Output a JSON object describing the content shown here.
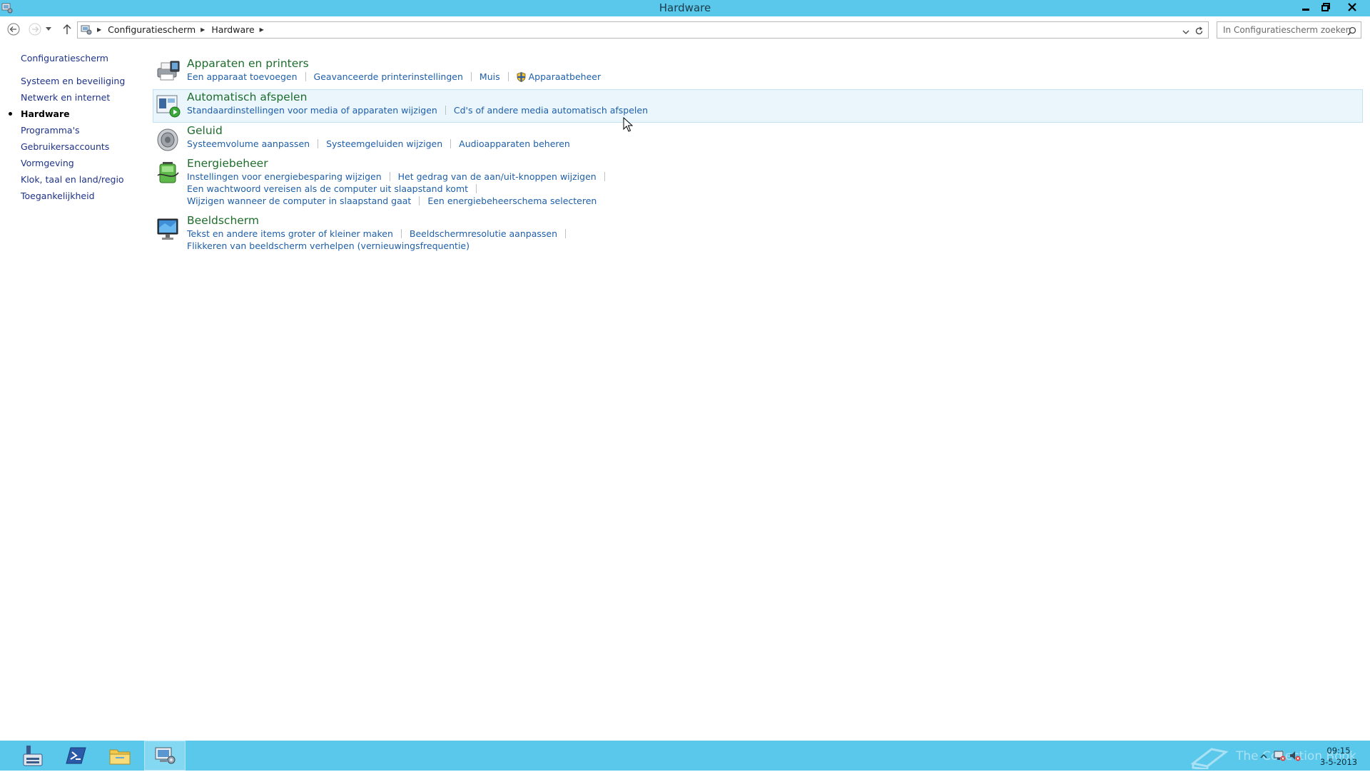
{
  "window": {
    "title": "Hardware",
    "controls": {
      "minimize": "minimize-icon",
      "restore": "restore-icon",
      "close": "close-icon"
    }
  },
  "navbar": {
    "breadcrumbs": [
      "Configuratiescherm",
      "Hardware"
    ],
    "search_placeholder": "In Configuratiescherm zoeken"
  },
  "sidebar": {
    "home": "Configuratiescherm",
    "items": [
      {
        "label": "Systeem en beveiliging",
        "current": false
      },
      {
        "label": "Netwerk en internet",
        "current": false
      },
      {
        "label": "Hardware",
        "current": true
      },
      {
        "label": "Programma's",
        "current": false
      },
      {
        "label": "Gebruikersaccounts",
        "current": false
      },
      {
        "label": "Vormgeving",
        "current": false
      },
      {
        "label": "Klok, taal en land/regio",
        "current": false
      },
      {
        "label": "Toegankelijkheid",
        "current": false
      }
    ]
  },
  "categories": [
    {
      "title": "Apparaten en printers",
      "icon": "devices-printers-icon",
      "rows": [
        [
          "Een apparaat toevoegen",
          "Geavanceerde printerinstellingen",
          "Muis",
          "Apparaatbeheer"
        ]
      ]
    },
    {
      "title": "Automatisch afspelen",
      "icon": "autoplay-icon",
      "rows": [
        [
          "Standaardinstellingen voor media of apparaten wijzigen",
          "Cd's of andere media automatisch afspelen"
        ]
      ]
    },
    {
      "title": "Geluid",
      "icon": "speaker-icon",
      "rows": [
        [
          "Systeemvolume aanpassen",
          "Systeemgeluiden wijzigen",
          "Audioapparaten beheren"
        ]
      ]
    },
    {
      "title": "Energiebeheer",
      "icon": "battery-icon",
      "rows": [
        [
          "Instellingen voor energiebesparing wijzigen",
          "Het gedrag van de aan/uit-knoppen wijzigen"
        ],
        [
          "Een wachtwoord vereisen als de computer uit slaapstand komt"
        ],
        [
          "Wijzigen wanneer de computer in slaapstand gaat",
          "Een energiebeheerschema selecteren"
        ]
      ]
    },
    {
      "title": "Beeldscherm",
      "icon": "monitor-icon",
      "rows": [
        [
          "Tekst en andere items groter of kleiner maken",
          "Beeldschermresolutie aanpassen"
        ],
        [
          "Flikkeren van beeldscherm verhelpen (vernieuwingsfrequentie)"
        ]
      ]
    }
  ],
  "taskbar": {
    "apps": [
      "server-manager-icon",
      "powershell-icon",
      "file-explorer-icon",
      "control-panel-icon"
    ],
    "clock_time": "09:15",
    "clock_date": "3-5-2013",
    "watermark": "The Collection Book"
  },
  "colors": {
    "titlebar": "#5ac8ea",
    "link": "#1e5fa8",
    "category_title": "#1f6d2c",
    "sidebar_link": "#1e3287"
  }
}
